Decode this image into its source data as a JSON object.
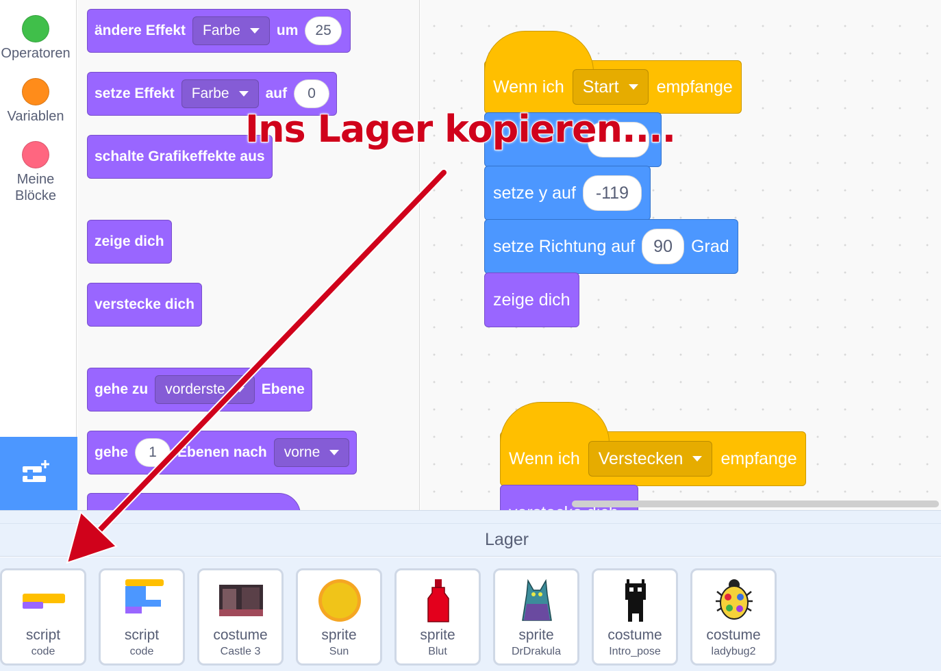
{
  "categories": [
    {
      "label": "Operatoren",
      "color": "#40bf4a"
    },
    {
      "label": "Variablen",
      "color": "#ff8c1a"
    },
    {
      "label": "Meine Blöcke",
      "color": "#ff6680"
    }
  ],
  "palette": {
    "change_effect": {
      "text1": "ändere Effekt",
      "dropdown": "Farbe",
      "text2": "um",
      "value": "25"
    },
    "set_effect": {
      "text1": "setze Effekt",
      "dropdown": "Farbe",
      "text2": "auf",
      "value": "0"
    },
    "clear_effects": "schalte Grafikeffekte aus",
    "show": "zeige dich",
    "hide": "verstecke dich",
    "goto_layer": {
      "text1": "gehe zu",
      "dropdown": "vorderste",
      "text2": "Ebene"
    },
    "go_layers": {
      "text1": "gehe",
      "value": "1",
      "text2": "Ebenen nach",
      "dropdown": "vorne"
    }
  },
  "workspace": {
    "script1": {
      "hat": {
        "text1": "Wenn ich",
        "dropdown": "Start",
        "text2": "empfange"
      },
      "set_y": {
        "text": "setze y auf",
        "value": "-119"
      },
      "direction": {
        "text1": "setze Richtung auf",
        "value": "90",
        "text2": "Grad"
      },
      "show": "zeige dich"
    },
    "script2": {
      "hat": {
        "text1": "Wenn ich",
        "dropdown": "Verstecken",
        "text2": "empfange"
      },
      "next": "verstecke dich"
    }
  },
  "annotation": "Ins Lager kopieren....",
  "annotation_color": "#d0021b",
  "backpack": {
    "title": "Lager",
    "items": [
      {
        "kind": "script",
        "name": "code",
        "icon": "script-thumb-icon"
      },
      {
        "kind": "script",
        "name": "code",
        "icon": "script-thumb-icon"
      },
      {
        "kind": "costume",
        "name": "Castle 3",
        "icon": "castle-thumb-icon"
      },
      {
        "kind": "sprite",
        "name": "Sun",
        "icon": "sun-thumb-icon"
      },
      {
        "kind": "sprite",
        "name": "Blut",
        "icon": "bottle-thumb-icon"
      },
      {
        "kind": "sprite",
        "name": "DrDrakula",
        "icon": "dracula-thumb-icon"
      },
      {
        "kind": "costume",
        "name": "Intro_pose",
        "icon": "pixel-figure-thumb-icon"
      },
      {
        "kind": "costume",
        "name": "ladybug2",
        "icon": "ladybug-thumb-icon"
      }
    ]
  }
}
